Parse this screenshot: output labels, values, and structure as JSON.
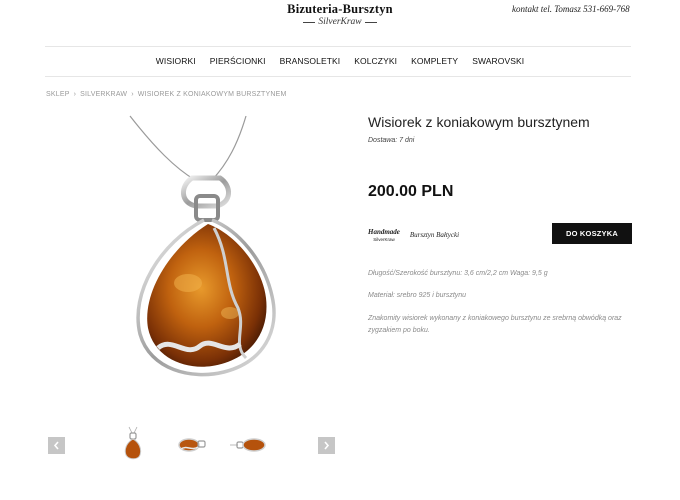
{
  "header": {
    "logo_main": "Bizuteria-Bursztyn",
    "logo_sub": "SilverKraw",
    "contact": "kontakt tel. Tomasz 531-669-768"
  },
  "nav": {
    "items": [
      "WISIORKI",
      "PIERŚCIONKI",
      "BRANSOLETKI",
      "KOLCZYKI",
      "KOMPLETY",
      "SWAROVSKI"
    ]
  },
  "breadcrumb": {
    "items": [
      "SKLEP",
      "SILVERKRAW",
      "WISIOREK Z KONIAKOWYM BURSZTYNEM"
    ],
    "separator": "›"
  },
  "product": {
    "title": "Wisiorek z koniakowym bursztynem",
    "delivery": "Dostawa: 7 dni",
    "price": "200.00 PLN",
    "add_to_cart": "DO KOSZYKA",
    "badge_handmade": "Handmade",
    "badge_handmade_sub": "SilverKraw",
    "badge_baltic": "Bursztyn Bałtycki",
    "spec_dimensions": "Długość/Szerokość bursztynu: 3,6 cm/2,2 cm Waga: 9,5 g",
    "spec_material": "Materiał: srebro 925 i bursztynu",
    "description": "Znakomity wisiorek wykonany z koniakowego bursztynu ze srebrną obwódką oraz zygzakiem po boku."
  },
  "gallery": {
    "prev_icon": "chevron-left-icon",
    "next_icon": "chevron-right-icon"
  },
  "colors": {
    "amber": "#b5520c",
    "button_bg": "#111111",
    "arrow_bg": "#c6c6c6"
  }
}
